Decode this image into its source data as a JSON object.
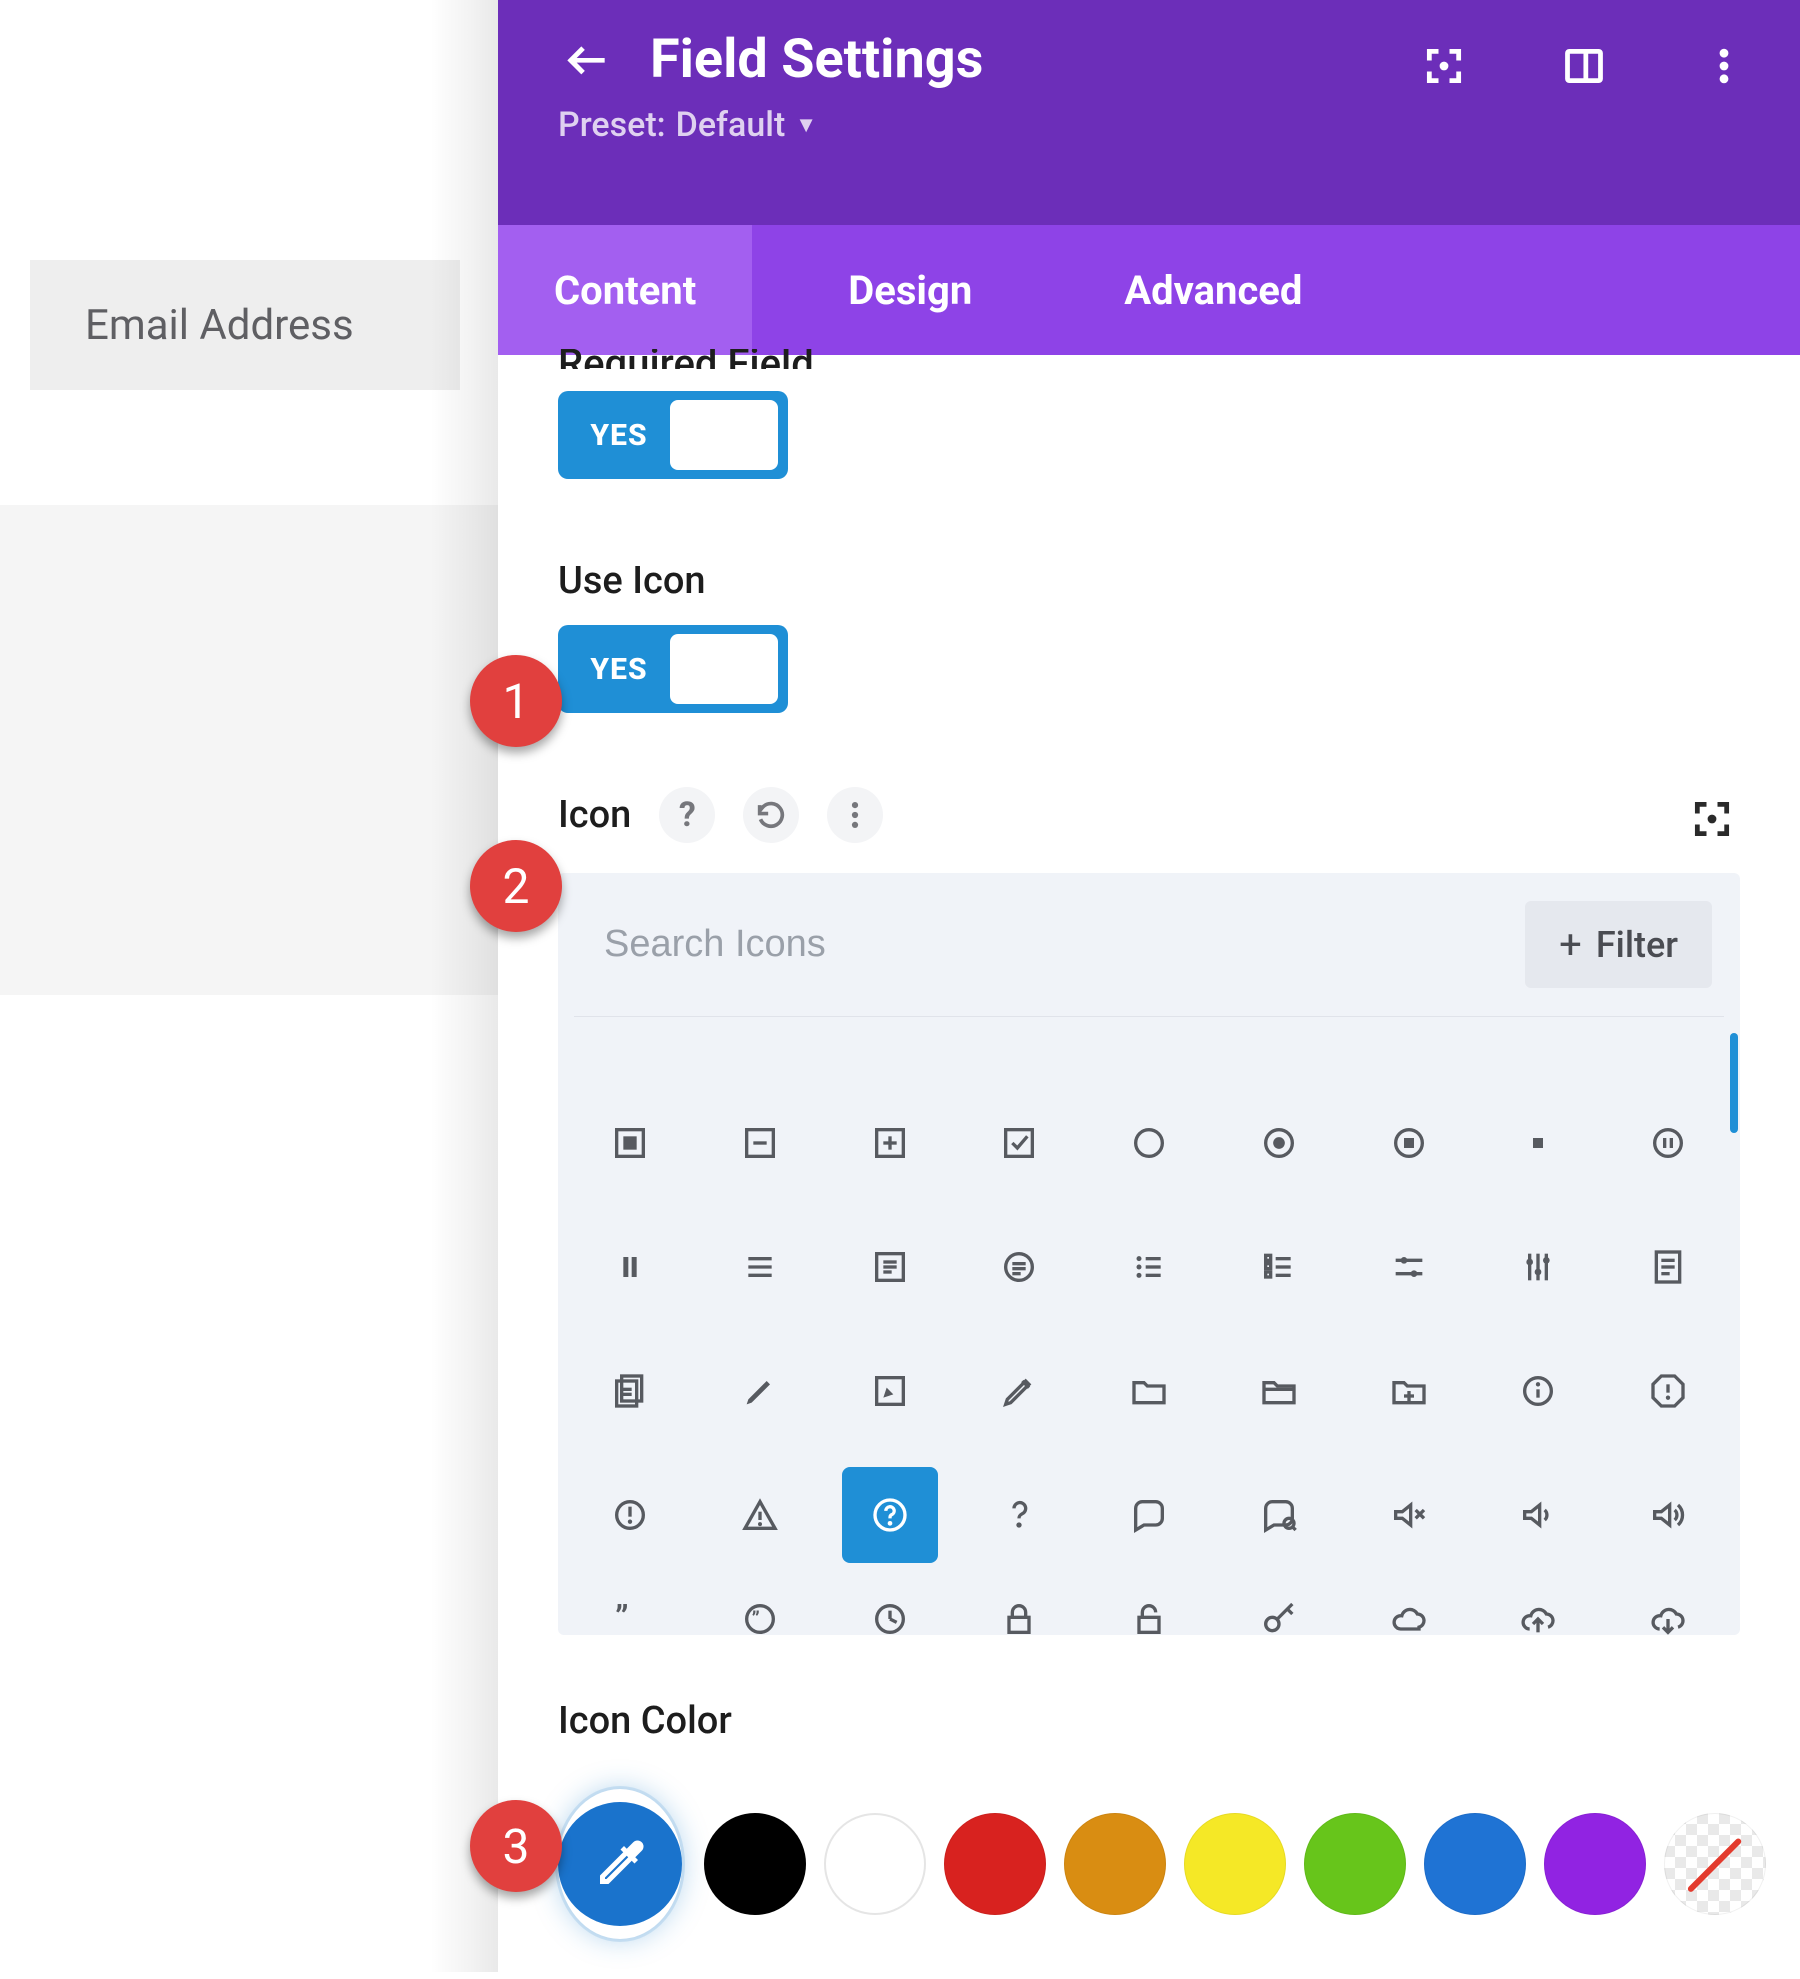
{
  "preview": {
    "field_label": "Email Address"
  },
  "header": {
    "title": "Field Settings",
    "preset_prefix": "Preset:",
    "preset_name": "Default"
  },
  "tabs": [
    {
      "label": "Content",
      "active": true
    },
    {
      "label": "Design",
      "active": false
    },
    {
      "label": "Advanced",
      "active": false
    }
  ],
  "required": {
    "label": "Required Field",
    "toggle_text": "YES"
  },
  "use_icon": {
    "label": "Use Icon",
    "toggle_text": "YES"
  },
  "icon_section": {
    "label": "Icon",
    "search_placeholder": "Search Icons",
    "filter_label": "Filter",
    "selected_icon": "help-circle-icon",
    "rows": [
      [
        "stop-filled-icon",
        "minus-square-icon",
        "plus-square-icon",
        "check-square-icon",
        "circle-icon",
        "dot-circle-icon",
        "stop-circle-icon",
        "square-small-icon",
        "pause-circle-icon"
      ],
      [
        "pause-icon",
        "menu-lines-icon",
        "text-box-icon",
        "text-circle-icon",
        "list-dots-icon",
        "list-numbered-icon",
        "sliders-h-icon",
        "sliders-v-icon",
        "file-text-icon"
      ],
      [
        "files-icon",
        "pencil-icon",
        "compose-box-icon",
        "compose-icon",
        "folder-icon",
        "folder-bar-icon",
        "folder-plus-icon",
        "info-circle-icon",
        "alert-octagon-icon"
      ],
      [
        "alert-circle-icon",
        "alert-triangle-icon",
        "help-circle-icon",
        "question-icon",
        "chat-bubble-icon",
        "chat-search-icon",
        "volume-mute-icon",
        "volume-low-icon",
        "volume-high-icon"
      ],
      [
        "quote-close-icon",
        "quote-circle-icon",
        "clock-icon",
        "lock-icon",
        "lock-open-icon",
        "key-icon",
        "cloud-icon",
        "cloud-up-icon",
        "cloud-down-icon"
      ]
    ]
  },
  "icon_color": {
    "label": "Icon Color",
    "swatches": [
      "#000000",
      "#ffffff",
      "#d8221f",
      "#d98d12",
      "#f5e826",
      "#67c51b",
      "#1f73d4",
      "#9123e2",
      "none"
    ]
  },
  "annotations": {
    "step1": "1",
    "step2": "2",
    "step3": "3"
  }
}
